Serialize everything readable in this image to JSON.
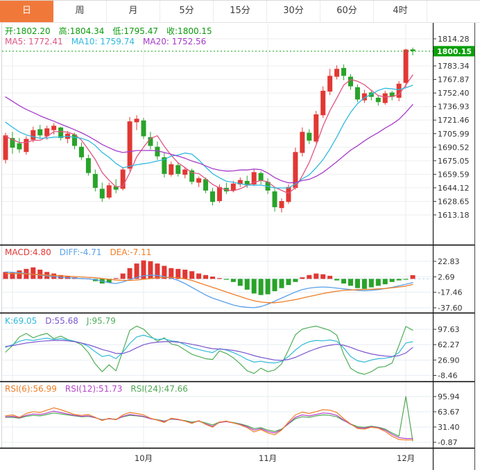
{
  "toolbar": {
    "tabs": [
      {
        "label": "日",
        "name": "tab-day",
        "active": true
      },
      {
        "label": "周",
        "name": "tab-week",
        "active": false
      },
      {
        "label": "月",
        "name": "tab-month",
        "active": false
      },
      {
        "label": "5分",
        "name": "tab-5min",
        "active": false
      },
      {
        "label": "15分",
        "name": "tab-15min",
        "active": false
      },
      {
        "label": "30分",
        "name": "tab-30min",
        "active": false
      },
      {
        "label": "60分",
        "name": "tab-60min",
        "active": false
      },
      {
        "label": "4时",
        "name": "tab-4hour",
        "active": false
      }
    ]
  },
  "main": {
    "ohlc": {
      "open": "开:1802.20",
      "high": "高:1804.34",
      "low": "低:1795.47",
      "close": "收:1800.15"
    },
    "ma": {
      "ma5": "MA5: 1772.41",
      "ma10": "MA10: 1759.74",
      "ma20": "MA20: 1752.56"
    },
    "price_badge": "1800.15",
    "axis": [
      "1814.28",
      "1783.34",
      "1767.87",
      "1752.40",
      "1736.93",
      "1721.46",
      "1705.99",
      "1690.52",
      "1675.05",
      "1659.59",
      "1644.12",
      "1628.65",
      "1613.18"
    ]
  },
  "macd": {
    "labels": {
      "macd": "MACD:4.80",
      "diff": "DIFF:-4.71",
      "dea": "DEA:-7.11"
    },
    "axis": [
      "22.83",
      "2.69",
      "-17.46",
      "-37.60"
    ]
  },
  "kdj": {
    "labels": {
      "k": "K:69.05",
      "d": "D:55.68",
      "j": "J:95.79"
    },
    "axis": [
      "97.63",
      "62.27",
      "26.90",
      "-8.46"
    ]
  },
  "rsi": {
    "labels": {
      "rsi6": "RSI(6):56.99",
      "rsi12": "RSI(12):51.73",
      "rsi24": "RSI(24):47.66"
    },
    "axis": [
      "95.94",
      "63.67",
      "31.40",
      "-0.87"
    ]
  },
  "xaxis": {
    "labels": [
      "10月",
      "11月",
      "12月"
    ]
  },
  "colors": {
    "up": "#e13834",
    "down": "#29a32a",
    "price_text": "#0a9b0a",
    "badge_bg": "#0aa00a",
    "ma5": "#e05580",
    "ma10": "#2fb9e0",
    "ma20": "#a63bc9",
    "diff": "#5aa0e8",
    "dea": "#ef7d25",
    "k": "#2fb9d8",
    "d": "#7a55cc",
    "j": "#4fae57",
    "rsi6": "#ef7d25",
    "rsi12": "#b444c8",
    "rsi24": "#4fa852",
    "axis_text": "#333333",
    "grid": "#eeeeee",
    "subgrid": "#e7edf3",
    "separator": "#000000",
    "tab_active_bg": "#f0793a",
    "zero_dash": "#b5d5ee"
  },
  "chart_data": {
    "type": "candlestick+indicators",
    "title": "Gold daily candlestick chart with MA5/MA10/MA20, MACD, KDJ, RSI",
    "current_price": 1800.15,
    "last_bar": {
      "open": 1802.2,
      "high": 1804.34,
      "low": 1795.47,
      "close": 1800.15
    },
    "ma_values": {
      "ma5": 1772.41,
      "ma10": 1759.74,
      "ma20": 1752.56
    },
    "ylim_main": [
      1613.18,
      1814.28
    ],
    "candles": [
      [
        1676,
        1707,
        1672,
        1704
      ],
      [
        1701,
        1708,
        1683,
        1690
      ],
      [
        1695,
        1701,
        1684,
        1688
      ],
      [
        1685,
        1703,
        1682,
        1700
      ],
      [
        1699,
        1714,
        1696,
        1710
      ],
      [
        1711,
        1716,
        1700,
        1704
      ],
      [
        1703,
        1715,
        1699,
        1712
      ],
      [
        1710,
        1718,
        1705,
        1715
      ],
      [
        1713,
        1714,
        1698,
        1701
      ],
      [
        1700,
        1709,
        1695,
        1706
      ],
      [
        1705,
        1707,
        1688,
        1692
      ],
      [
        1691,
        1696,
        1676,
        1679
      ],
      [
        1678,
        1682,
        1658,
        1661
      ],
      [
        1660,
        1665,
        1640,
        1644
      ],
      [
        1643,
        1650,
        1628,
        1632
      ],
      [
        1633,
        1650,
        1631,
        1647
      ],
      [
        1646,
        1654,
        1638,
        1642
      ],
      [
        1643,
        1668,
        1641,
        1665
      ],
      [
        1666,
        1725,
        1663,
        1720
      ],
      [
        1719,
        1727,
        1710,
        1723
      ],
      [
        1721,
        1724,
        1700,
        1703
      ],
      [
        1702,
        1708,
        1688,
        1692
      ],
      [
        1691,
        1697,
        1676,
        1680
      ],
      [
        1679,
        1684,
        1656,
        1660
      ],
      [
        1659,
        1674,
        1657,
        1671
      ],
      [
        1670,
        1673,
        1657,
        1660
      ],
      [
        1659,
        1668,
        1655,
        1665
      ],
      [
        1664,
        1666,
        1648,
        1651
      ],
      [
        1650,
        1657,
        1645,
        1655
      ],
      [
        1654,
        1656,
        1638,
        1641
      ],
      [
        1640,
        1644,
        1624,
        1628
      ],
      [
        1629,
        1648,
        1627,
        1645
      ],
      [
        1644,
        1650,
        1637,
        1640
      ],
      [
        1641,
        1652,
        1639,
        1649
      ],
      [
        1648,
        1656,
        1645,
        1653
      ],
      [
        1652,
        1658,
        1644,
        1647
      ],
      [
        1648,
        1665,
        1646,
        1662
      ],
      [
        1661,
        1663,
        1648,
        1652
      ],
      [
        1651,
        1655,
        1637,
        1641
      ],
      [
        1640,
        1643,
        1617,
        1622
      ],
      [
        1621,
        1632,
        1616,
        1629
      ],
      [
        1628,
        1648,
        1626,
        1645
      ],
      [
        1644,
        1690,
        1642,
        1685
      ],
      [
        1684,
        1713,
        1680,
        1708
      ],
      [
        1707,
        1711,
        1694,
        1698
      ],
      [
        1697,
        1732,
        1695,
        1728
      ],
      [
        1727,
        1760,
        1724,
        1755
      ],
      [
        1754,
        1780,
        1750,
        1772
      ],
      [
        1771,
        1784,
        1768,
        1780
      ],
      [
        1781,
        1785,
        1767,
        1772
      ],
      [
        1771,
        1774,
        1756,
        1760
      ],
      [
        1759,
        1762,
        1742,
        1745
      ],
      [
        1744,
        1756,
        1741,
        1752
      ],
      [
        1753,
        1756,
        1744,
        1748
      ],
      [
        1747,
        1750,
        1738,
        1742
      ],
      [
        1741,
        1755,
        1739,
        1752
      ],
      [
        1753,
        1755,
        1744,
        1748
      ],
      [
        1747,
        1766,
        1743,
        1763
      ],
      [
        1764,
        1803,
        1758,
        1802
      ],
      [
        1802.2,
        1804.34,
        1795.47,
        1800.15
      ]
    ],
    "prehistory_closes": [
      1790,
      1788,
      1785,
      1782,
      1779,
      1776,
      1773,
      1770,
      1767,
      1759,
      1747,
      1741,
      1735,
      1729,
      1723,
      1709,
      1705,
      1700,
      1697
    ],
    "ma_periods": [
      5,
      10,
      20
    ],
    "macd": {
      "hist": [
        9,
        8,
        11,
        13,
        15,
        12,
        9,
        7,
        5,
        4,
        2,
        1,
        0.5,
        -3,
        -6,
        -5,
        1,
        7,
        14,
        20,
        24,
        23,
        20,
        17,
        14,
        13,
        12,
        10,
        7,
        5,
        3,
        1,
        -0.5,
        -4,
        -9,
        -14,
        -19,
        -21,
        -20,
        -16,
        -12,
        -8,
        -4,
        2,
        5,
        7,
        6,
        4,
        -2,
        -6,
        -9,
        -12,
        -13,
        -11,
        -9,
        -7,
        -4,
        -2,
        -1,
        4.8
      ],
      "diff": [
        9,
        8.5,
        8,
        7,
        6,
        5,
        4,
        3,
        2,
        1.5,
        1,
        0.5,
        0,
        -1,
        -3,
        -5,
        -6,
        -4,
        -1,
        2,
        4,
        5,
        4.5,
        3,
        1,
        -2,
        -6,
        -11,
        -16,
        -21,
        -25,
        -28,
        -31,
        -34,
        -36,
        -37,
        -37.5,
        -36,
        -33,
        -29,
        -25,
        -21,
        -17,
        -14,
        -12,
        -11,
        -10.5,
        -11,
        -12,
        -13,
        -14,
        -15,
        -15.5,
        -15,
        -14,
        -12.5,
        -11,
        -9,
        -7,
        -4.71
      ],
      "dea": [
        7,
        7,
        6.8,
        6.5,
        6,
        5.5,
        5,
        4.5,
        4,
        3.5,
        3,
        2.5,
        2,
        1.5,
        0.5,
        -0.5,
        -1.5,
        -2,
        -2,
        -1.5,
        -0.5,
        0.5,
        1.5,
        2,
        2,
        1.5,
        0,
        -2,
        -5,
        -8,
        -11,
        -14,
        -17,
        -20,
        -23,
        -26,
        -28.5,
        -30,
        -31,
        -31,
        -30,
        -28.5,
        -27,
        -25,
        -23,
        -21,
        -19,
        -17.5,
        -16,
        -15,
        -14.5,
        -14,
        -13.8,
        -13.5,
        -13,
        -12.5,
        -11.5,
        -10.5,
        -9.5,
        -7.11
      ]
    },
    "kdj": {
      "k": [
        56,
        62,
        70,
        74,
        72,
        75,
        77,
        74,
        76,
        73,
        70,
        66,
        58,
        46,
        35,
        38,
        30,
        45,
        65,
        80,
        84,
        79,
        74,
        76,
        71,
        69,
        62,
        55,
        51,
        47,
        44,
        53,
        50,
        44,
        37,
        28,
        22,
        24,
        21,
        20,
        24,
        35,
        50,
        62,
        69,
        72,
        71,
        73,
        70,
        55,
        35,
        25,
        22,
        27,
        30,
        31,
        34,
        44,
        66,
        69.05
      ],
      "d": [
        58,
        60,
        63,
        66,
        68,
        70,
        71,
        72,
        72,
        71,
        69,
        66,
        62,
        57,
        51,
        47,
        42,
        42,
        47,
        55,
        62,
        66,
        68,
        69,
        69,
        68,
        66,
        63,
        60,
        56,
        53,
        52,
        51,
        49,
        46,
        42,
        37,
        33,
        30,
        27,
        26,
        28,
        33,
        40,
        47,
        53,
        58,
        61,
        63,
        61,
        56,
        50,
        45,
        41,
        38,
        36,
        35,
        37,
        43,
        55.68
      ],
      "j": [
        45,
        60,
        80,
        88,
        78,
        84,
        88,
        76,
        82,
        74,
        70,
        62,
        44,
        18,
        0,
        16,
        2,
        48,
        95,
        105,
        98,
        82,
        70,
        78,
        64,
        60,
        50,
        40,
        35,
        30,
        28,
        48,
        42,
        32,
        18,
        2,
        -4,
        8,
        0,
        4,
        18,
        50,
        85,
        98,
        102,
        105,
        100,
        95,
        84,
        40,
        8,
        -2,
        -6,
        0,
        10,
        12,
        20,
        60,
        104,
        95.79
      ]
    },
    "rsi": {
      "r6": [
        55,
        57,
        52,
        60,
        64,
        62,
        67,
        72,
        68,
        63,
        58,
        56,
        58,
        52,
        45,
        50,
        47,
        57,
        62,
        60,
        57,
        50,
        46,
        41,
        50,
        48,
        44,
        39,
        45,
        37,
        31,
        42,
        44,
        40,
        36,
        30,
        21,
        26,
        19,
        15,
        25,
        42,
        57,
        63,
        60,
        64,
        68,
        67,
        62,
        49,
        38,
        28,
        27,
        31,
        29,
        22,
        12,
        5,
        4,
        4
      ],
      "r12": [
        53,
        54,
        51,
        56,
        59,
        58,
        61,
        65,
        62,
        59,
        56,
        54,
        55,
        51,
        46,
        49,
        47,
        54,
        58,
        56,
        54,
        49,
        46,
        43,
        49,
        47,
        44,
        40,
        44,
        38,
        33,
        41,
        43,
        40,
        37,
        32,
        25,
        28,
        22,
        19,
        26,
        39,
        52,
        57,
        55,
        58,
        61,
        60,
        56,
        46,
        37,
        30,
        29,
        32,
        30,
        25,
        16,
        9,
        7,
        7
      ],
      "r24": [
        52,
        52,
        50,
        54,
        56,
        55,
        58,
        61,
        59,
        57,
        55,
        53,
        54,
        51,
        47,
        49,
        48,
        53,
        56,
        55,
        53,
        49,
        47,
        44,
        48,
        47,
        45,
        42,
        44,
        40,
        36,
        42,
        43,
        41,
        38,
        34,
        28,
        30,
        25,
        22,
        27,
        38,
        49,
        53,
        52,
        55,
        57,
        56,
        53,
        45,
        38,
        32,
        31,
        33,
        31,
        27,
        19,
        12,
        96,
        2
      ]
    },
    "month_label_indices": [
      20,
      38,
      58
    ],
    "vline_indices": [
      1,
      20,
      38,
      58
    ]
  }
}
